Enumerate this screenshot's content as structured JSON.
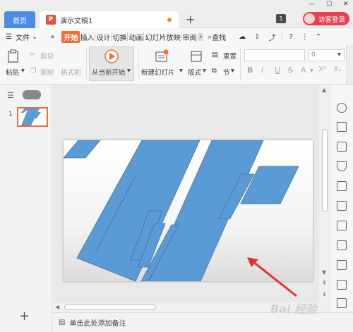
{
  "titlebar": {
    "home_tab": "首页",
    "doc_badge": "P",
    "doc_name": "演示文稿1",
    "new_tab": "+",
    "page_count": "1",
    "login": "访客登录"
  },
  "menubar": {
    "file": "文件",
    "more_left": "»",
    "tabs": [
      "开始",
      "插入",
      "设计",
      "切换",
      "动画",
      "幻灯片放映",
      "审阅"
    ],
    "search": "查找",
    "help": "?",
    "more_menu": "⋮"
  },
  "ribbon": {
    "paste": "粘贴",
    "cut": "剪切",
    "copy": "复制",
    "format_painter": "格式刷",
    "play_from_current": "从当前开始",
    "new_slide": "新建幻灯片",
    "layout": "版式",
    "reset": "重置",
    "section": "节",
    "font_size": "0",
    "format_buttons": [
      "B",
      "I",
      "U",
      "S",
      "A",
      "X²",
      "X₂"
    ]
  },
  "slides_panel": {
    "slide_number": "1",
    "add_slide": "+"
  },
  "notes": {
    "placeholder": "单击此处添加备注"
  },
  "watermark": "Bai 经验",
  "colors": {
    "accent": "#ee6d3a",
    "home_tab": "#4b8de6",
    "login": "#e8414f",
    "shape_fill": "#5b9bd5",
    "shape_stroke": "#41719c",
    "arrow": "#e5312f"
  }
}
